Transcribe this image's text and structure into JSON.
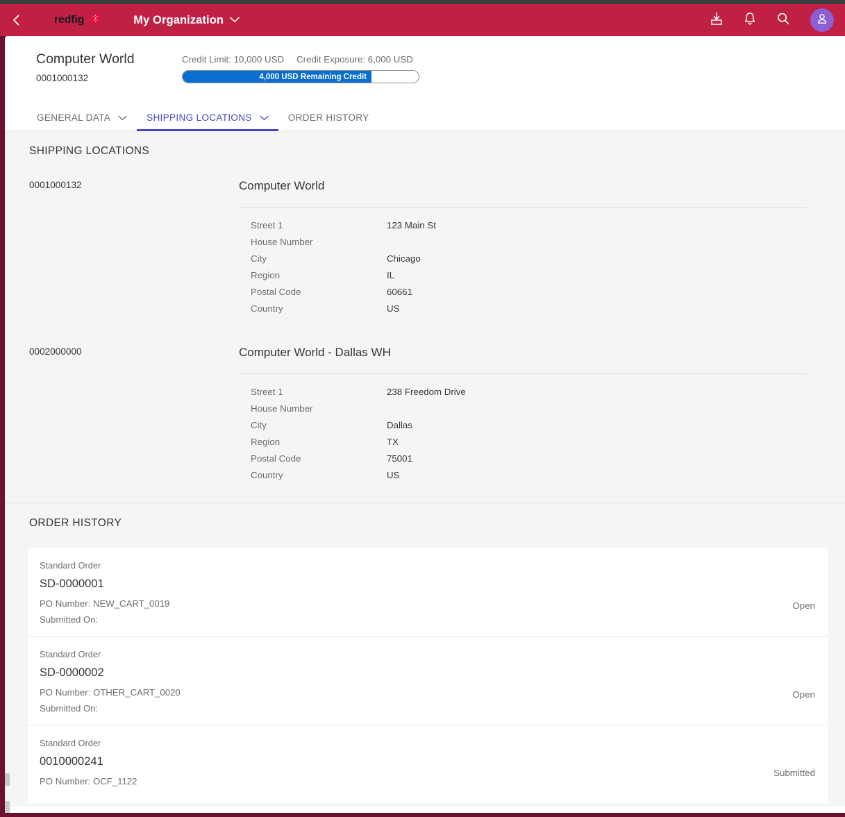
{
  "header": {
    "back_icon": "chevron-left-icon",
    "brand_word": "redfig",
    "brand_mark_icon": "fig-logo-icon",
    "org_name": "My Organization",
    "org_caret_icon": "chevron-down-icon",
    "actions": [
      {
        "icon": "inbox-download-icon",
        "name": "downloads-button"
      },
      {
        "icon": "bell-icon",
        "name": "notifications-button"
      },
      {
        "icon": "search-icon",
        "name": "search-button"
      }
    ],
    "avatar_icon": "user-avatar-icon",
    "accent_color": "#c02044",
    "avatar_color": "#8d5fd3"
  },
  "object_header": {
    "title": "Computer World",
    "subtitle": "0001000132",
    "credit_limit": "Credit Limit: 10,000 USD",
    "credit_exposure": "Credit Exposure: 6,000 USD",
    "progress": {
      "label": "4,000 USD Remaining Credit",
      "percent": 80,
      "fill_color": "#0a6ed1"
    }
  },
  "tabs": [
    {
      "label": "GENERAL DATA",
      "active": false,
      "has_caret": true
    },
    {
      "label": "SHIPPING LOCATIONS",
      "active": true,
      "has_caret": true
    },
    {
      "label": "ORDER HISTORY",
      "active": false,
      "has_caret": false
    }
  ],
  "tab_active_color": "#4a45c4",
  "shipping": {
    "section_title": "SHIPPING LOCATIONS",
    "locations": [
      {
        "id": "0001000132",
        "name": "Computer World",
        "fields": [
          {
            "label": "Street 1",
            "value": "123 Main St"
          },
          {
            "label": "House Number",
            "value": ""
          },
          {
            "label": "City",
            "value": "Chicago"
          },
          {
            "label": "Region",
            "value": "IL"
          },
          {
            "label": "Postal Code",
            "value": "60661"
          },
          {
            "label": "Country",
            "value": "US"
          }
        ]
      },
      {
        "id": "0002000000",
        "name": "Computer World - Dallas WH",
        "fields": [
          {
            "label": "Street 1",
            "value": "238 Freedom Drive"
          },
          {
            "label": "House Number",
            "value": ""
          },
          {
            "label": "City",
            "value": "Dallas"
          },
          {
            "label": "Region",
            "value": "TX"
          },
          {
            "label": "Postal Code",
            "value": "75001"
          },
          {
            "label": "Country",
            "value": "US"
          }
        ]
      }
    ]
  },
  "orders": {
    "section_title": "ORDER HISTORY",
    "items": [
      {
        "type": "Standard Order",
        "id": "SD-0000001",
        "po": "PO Number: NEW_CART_0019",
        "submitted": "Submitted On:",
        "status": "Open"
      },
      {
        "type": "Standard Order",
        "id": "SD-0000002",
        "po": "PO Number: OTHER_CART_0020",
        "submitted": "Submitted On:",
        "status": "Open"
      },
      {
        "type": "Standard Order",
        "id": "0010000241",
        "po": "PO Number: OCF_1122",
        "submitted": "",
        "status": "Submitted"
      }
    ]
  }
}
